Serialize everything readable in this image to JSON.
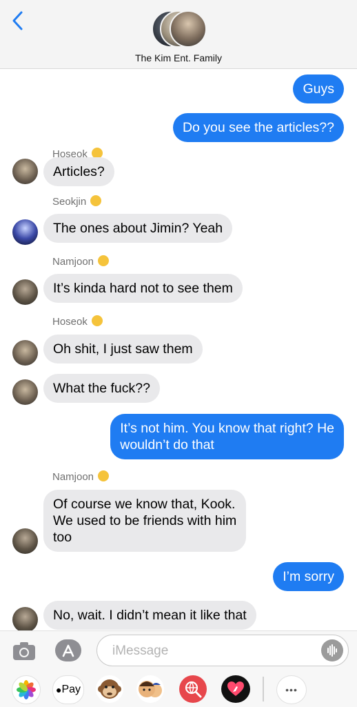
{
  "header": {
    "group_name": "The Kim Ent. Family"
  },
  "messages": [
    {
      "type": "out",
      "text": "Guys"
    },
    {
      "type": "out",
      "text": "Do you see the articles??"
    },
    {
      "type": "sender",
      "text": "Hoseok"
    },
    {
      "type": "in",
      "text": "Articles?"
    },
    {
      "type": "sender",
      "text": "Seokjin"
    },
    {
      "type": "in",
      "text": "The ones about Jimin? Yeah"
    },
    {
      "type": "sender",
      "text": "Namjoon"
    },
    {
      "type": "in",
      "text": "It’s kinda hard not to see them"
    },
    {
      "type": "sender",
      "text": "Hoseok"
    },
    {
      "type": "in",
      "text": "Oh shit, I just saw them"
    },
    {
      "type": "in",
      "text": "What the fuck??"
    },
    {
      "type": "out",
      "text": "It’s not him. You know that right? He\nwouldn’t do that"
    },
    {
      "type": "sender",
      "text": "Namjoon"
    },
    {
      "type": "in",
      "text": "Of course we know that, Kook.\nWe used to be friends with him\ntoo"
    },
    {
      "type": "out",
      "text": "I’m sorry"
    },
    {
      "type": "in",
      "text": "No, wait. I didn’t mean it like that"
    }
  ],
  "composer": {
    "placeholder": "iMessage"
  },
  "apps": {
    "apple_pay_label": "Pay",
    "more_label": "•••"
  },
  "colors": {
    "outgoing_bubble": "#1f7cf2",
    "incoming_bubble": "#e9e9eb",
    "back_arrow": "#1f7cf2"
  }
}
